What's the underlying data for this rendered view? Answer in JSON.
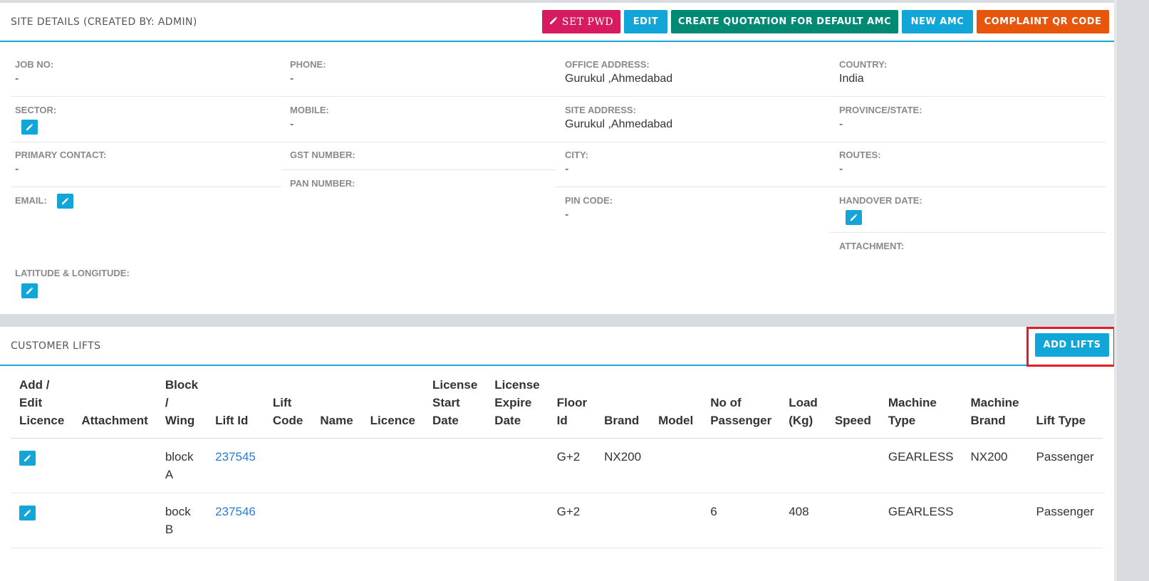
{
  "site": {
    "title": "SITE DETAILS (CREATED BY: ADMIN)",
    "buttons": {
      "set_pwd": "SET PWD",
      "edit": "EDIT",
      "create_quotation": "CREATE QUOTATION FOR DEFAULT AMC",
      "new_amc": "NEW AMC",
      "complaint_qr": "COMPLAINT QR CODE"
    },
    "fields": {
      "job_no": {
        "label": "JOB NO:",
        "value": "-"
      },
      "phone": {
        "label": "PHONE:",
        "value": "-"
      },
      "office_address": {
        "label": "OFFICE ADDRESS:",
        "value": "Gurukul ,Ahmedabad"
      },
      "country": {
        "label": "COUNTRY:",
        "value": "India"
      },
      "sector": {
        "label": "SECTOR:"
      },
      "mobile": {
        "label": "MOBILE:",
        "value": "-"
      },
      "site_address": {
        "label": "SITE ADDRESS:",
        "value": "Gurukul ,Ahmedabad"
      },
      "province": {
        "label": "PROVINCE/STATE:",
        "value": "-"
      },
      "primary_contact": {
        "label": "PRIMARY CONTACT:",
        "value": "-"
      },
      "gst_number": {
        "label": "GST NUMBER:"
      },
      "city": {
        "label": "CITY:",
        "value": "-"
      },
      "routes": {
        "label": "ROUTES:",
        "value": "-"
      },
      "pan_number": {
        "label": "PAN NUMBER:"
      },
      "email": {
        "label": "EMAIL:"
      },
      "pin_code": {
        "label": "PIN CODE:",
        "value": "-"
      },
      "handover_date": {
        "label": "HANDOVER DATE:"
      },
      "attachment": {
        "label": "ATTACHMENT:"
      },
      "lat_long": {
        "label": "LATITUDE & LONGITUDE:"
      }
    }
  },
  "lifts": {
    "title": "CUSTOMER LIFTS",
    "add_button": "ADD LIFTS",
    "columns": [
      [
        "Add /",
        "Edit",
        "Licence"
      ],
      [
        "Attachment"
      ],
      [
        "Block",
        "/",
        "Wing"
      ],
      [
        "Lift Id"
      ],
      [
        "Lift",
        "Code"
      ],
      [
        "Name"
      ],
      [
        "Licence"
      ],
      [
        "License",
        "Start",
        "Date"
      ],
      [
        "License",
        "Expire",
        "Date"
      ],
      [
        "Floor",
        "Id"
      ],
      [
        "Brand"
      ],
      [
        "Model"
      ],
      [
        "No of",
        "Passenger"
      ],
      [
        "Load",
        "(Kg)"
      ],
      [
        "Speed"
      ],
      [
        "Machine",
        "Type"
      ],
      [
        "Machine",
        "Brand"
      ],
      [
        "Lift Type"
      ]
    ],
    "rows": [
      {
        "block": [
          "block",
          "A"
        ],
        "lift_id": "237545",
        "lift_code": "",
        "name": "",
        "licence": "",
        "license_start": "",
        "license_expire": "",
        "floor_id": "G+2",
        "brand": "NX200",
        "model": "",
        "passenger": "",
        "load": "",
        "speed": "",
        "machine_type": "GEARLESS",
        "machine_brand": "NX200",
        "lift_type": "Passenger"
      },
      {
        "block": [
          "bock",
          "B"
        ],
        "lift_id": "237546",
        "lift_code": "",
        "name": "",
        "licence": "",
        "license_start": "",
        "license_expire": "",
        "floor_id": "G+2",
        "brand": "",
        "model": "",
        "passenger": "6",
        "load": "408",
        "speed": "",
        "machine_type": "GEARLESS",
        "machine_brand": "",
        "lift_type": "Passenger"
      }
    ]
  },
  "icons": {
    "edit": "pencil-icon"
  },
  "colors": {
    "accent": "#12a5d8",
    "pink": "#d81b60",
    "teal": "#008a73",
    "orange": "#e8560c",
    "highlight": "#e31b23",
    "link": "#2a7bd6"
  }
}
